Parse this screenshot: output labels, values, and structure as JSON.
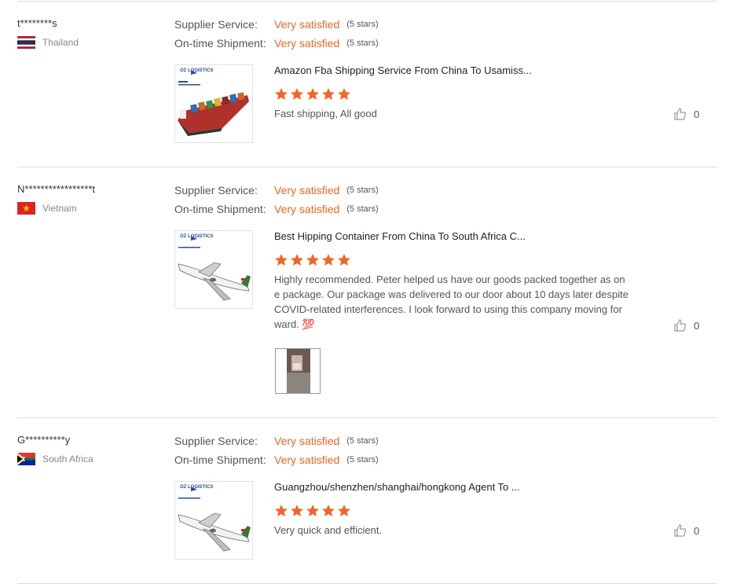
{
  "labels": {
    "supplier_service": "Supplier Service:",
    "ontime_shipment": "On-time Shipment:"
  },
  "logo_text": "OZ LOGISTICS",
  "colors": {
    "accent": "#f26522",
    "divider": "#dcdcdc",
    "muted": "#888888"
  },
  "reviews": [
    {
      "buyer": "t********s",
      "country": "Thailand",
      "flag": "thailand-flag",
      "supplier_service": {
        "value": "Very satisfied",
        "stars": "(5 stars)"
      },
      "ontime_shipment": {
        "value": "Very satisfied",
        "stars": "(5 stars)"
      },
      "product_image": "cargo-ship-image",
      "product_title": "Amazon Fba Shipping Service From China To Usamiss...",
      "rating": 5,
      "comment": "Fast shipping,  All good",
      "likes": "0"
    },
    {
      "buyer": "N*****************t",
      "country": "Vietnam",
      "flag": "vietnam-flag",
      "supplier_service": {
        "value": "Very satisfied",
        "stars": "(5 stars)"
      },
      "ontime_shipment": {
        "value": "Very satisfied",
        "stars": "(5 stars)"
      },
      "product_image": "airplane-image",
      "product_title": "Best Hipping Container From China To South Africa C...",
      "rating": 5,
      "comment": "Highly recommended. Peter helped us have our goods packed together as one package. Our package was delivered to our door about 10 days later despite COVID-related interferences. I look forward to using this company moving forward. 💯",
      "likes": "0",
      "has_photo": true
    },
    {
      "buyer": "G**********y",
      "country": "South Africa",
      "flag": "south-africa-flag",
      "supplier_service": {
        "value": "Very satisfied",
        "stars": "(5 stars)"
      },
      "ontime_shipment": {
        "value": "Very satisfied",
        "stars": "(5 stars)"
      },
      "product_image": "airplane-image",
      "product_title": "Guangzhou/shenzhen/shanghai/hongkong Agent To ...",
      "rating": 5,
      "comment": "Very quick and efficient.",
      "likes": "0"
    }
  ]
}
